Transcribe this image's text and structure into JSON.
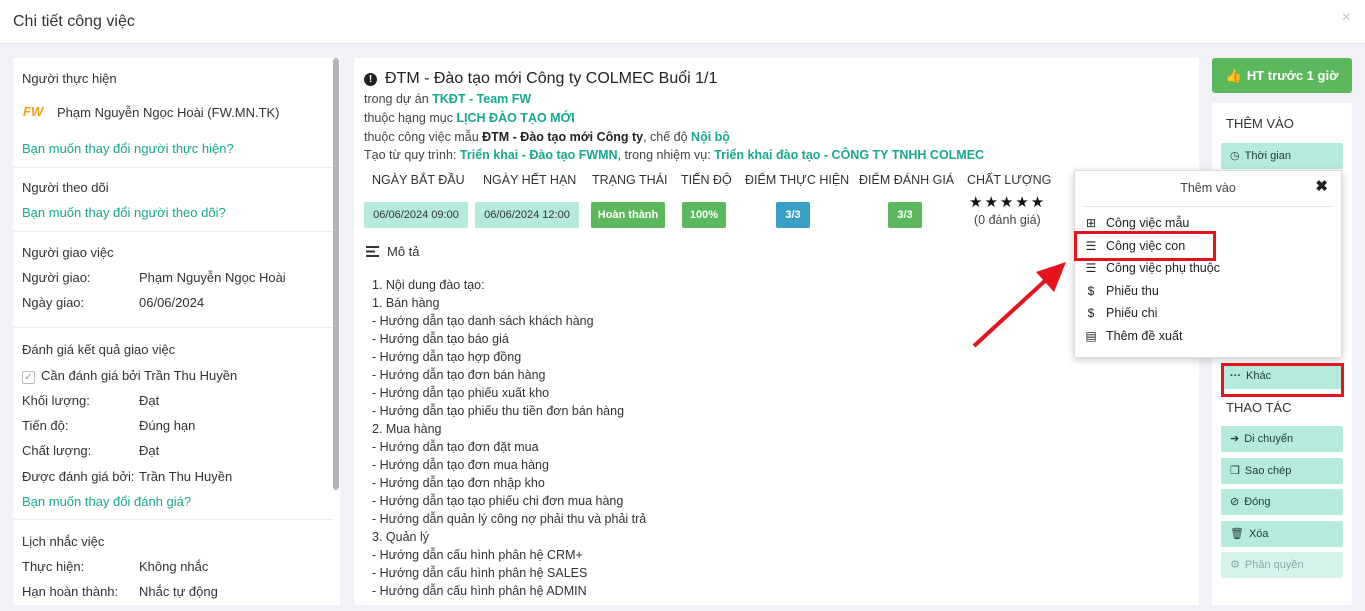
{
  "header": {
    "title": "Chi tiết công việc",
    "close": "×"
  },
  "left": {
    "performer": {
      "heading": "Người thực hiện",
      "logo_text": "FW",
      "name": "Phạm Nguyễn Ngọc Hoài (FW.MN.TK)",
      "change_link": "Bạn muốn thay đổi người thực hiện?"
    },
    "follower": {
      "heading": "Người theo dõi",
      "change_link": "Bạn muốn thay đổi người theo dõi?"
    },
    "assigner": {
      "heading": "Người giao việc",
      "k1": "Người giao:",
      "v1": "Phạm Nguyễn Ngọc Hoài",
      "k2": "Ngày giao:",
      "v2": "06/06/2024"
    },
    "evaluation": {
      "heading": "Đánh giá kết quả giao việc",
      "check_label": "Cần đánh giá bởi Trần Thu Huyền",
      "k1": "Khối lượng:",
      "v1": "Đạt",
      "k2": "Tiến độ:",
      "v2": "Đúng hạn",
      "k3": "Chất lượng:",
      "v3": "Đạt",
      "k4": "Được đánh giá bởi:",
      "v4": "Trần Thu Huyền",
      "change_link": "Bạn muốn thay đổi đánh giá?"
    },
    "reminder": {
      "heading": "Lịch nhắc việc",
      "k1": "Thực hiện:",
      "v1": "Không nhắc",
      "k2": "Hạn hoàn thành:",
      "v2": "Nhắc tự động"
    }
  },
  "main": {
    "title": "ĐTM - Đào tạo mới Công ty COLMEC Buổi 1/1",
    "line1_prefix": "trong dự án ",
    "line1_link": "TKĐT - Team FW",
    "line2_prefix": "thuộc hạng mục ",
    "line2_link": "LỊCH ĐÀO TẠO MỚI",
    "line3_prefix": "thuộc công việc mẫu ",
    "line3_bold": "ĐTM - Đào tạo mới Công ty",
    "line3_mid": ", chế độ ",
    "line3_link": "Nội bộ",
    "line4_prefix": "Tạo từ quy trình: ",
    "line4_link1": "Triển khai - Đào tạo FWMN",
    "line4_mid": ", trong nhiệm vụ: ",
    "line4_link2": "Triển khai đào tạo - CÔNG TY TNHH COLMEC",
    "columns": {
      "start": "NGÀY BẮT ĐẦU",
      "end": "NGÀY HẾT HẠN",
      "status": "TRẠNG THÁI",
      "progress": "TIẾN ĐỘ",
      "exec_score": "ĐIỂM THỰC HIỆN",
      "eval_score": "ĐIỂM ĐÁNH GIÁ",
      "quality": "CHẤT LƯỢNG"
    },
    "values": {
      "start": "06/06/2024 09:00",
      "end": "06/06/2024 12:00",
      "status": "Hoàn thành",
      "progress": "100%",
      "exec_score": "3/3",
      "eval_score": "3/3",
      "stars": "★★★★★",
      "rating": "(0 đánh giá)"
    },
    "description_heading": "Mô tả",
    "description": "1. Nội dung đào tạo:\n1. Bán hàng\n- Hướng dẫn tạo danh sách khách hàng\n- Hướng dẫn tạo báo giá\n- Hướng dẫn tạo hợp đồng\n- Hướng dẫn tạo đơn bán hàng\n- Hướng dẫn tạo phiếu xuất kho\n- Hướng dẫn tạo phiếu thu tiền đơn bán hàng\n2. Mua hàng\n- Hướng dẫn tạo đơn đặt mua\n- Hướng dẫn tạo đơn mua hàng\n- Hướng dẫn tạo đơn nhập kho\n- Hướng dẫn tạo tạo phiếu chi đơn mua hàng\n- Hướng dẫn quản lý công nợ phải thu và phải trả\n3. Quản lý\n- Hướng dẫn cấu hình phân hệ CRM+\n- Hướng dẫn cấu hình phân hệ SALES\n- Hướng dẫn cấu hình phân hệ ADMIN"
  },
  "right": {
    "top_button": "HT trước 1 giờ",
    "add_heading": "THÊM VÀO",
    "time_button": "Thời gian",
    "other_button": "Khác",
    "actions_heading": "THAO TÁC",
    "move": "Di chuyển",
    "copy": "Sao chép",
    "close": "Đóng",
    "delete": "Xóa",
    "permission": "Phân quyền"
  },
  "popup": {
    "title": "Thêm vào",
    "close": "✖",
    "items": [
      "Công việc mẫu",
      "Công việc con",
      "Công việc phụ thuộc",
      "Phiếu thu",
      "Phiếu chi",
      "Thêm đề xuất"
    ]
  },
  "colors": {
    "accent": "#17a891",
    "success": "#5cb85c",
    "info": "#3a9fc4",
    "highlight": "#e3141b"
  }
}
